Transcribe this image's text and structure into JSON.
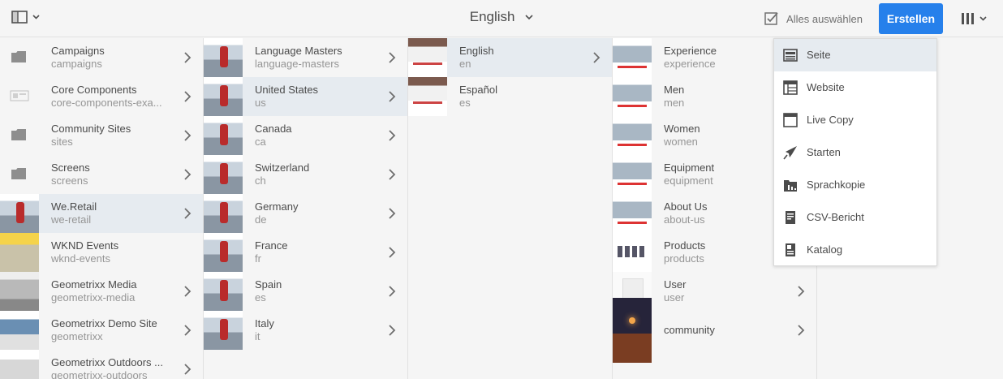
{
  "topbar": {
    "title": "English",
    "select_all": "Alles auswählen",
    "create": "Erstellen"
  },
  "col1": [
    {
      "title": "Campaigns",
      "name": "campaigns",
      "icon": "folder-icon"
    },
    {
      "title": "Core Components",
      "name": "core-components-exa...",
      "icon": "component-icon"
    },
    {
      "title": "Community Sites",
      "name": "sites",
      "icon": "folder-icon"
    },
    {
      "title": "Screens",
      "name": "screens",
      "icon": "folder-icon"
    },
    {
      "title": "We.Retail",
      "name": "we-retail",
      "selected": true
    },
    {
      "title": "WKND Events",
      "name": "wknd-events"
    },
    {
      "title": "Geometrixx Media",
      "name": "geometrixx-media"
    },
    {
      "title": "Geometrixx Demo Site",
      "name": "geometrixx"
    },
    {
      "title": "Geometrixx Outdoors ...",
      "name": "geometrixx-outdoors"
    }
  ],
  "col2": [
    {
      "title": "Language Masters",
      "name": "language-masters"
    },
    {
      "title": "United States",
      "name": "us",
      "selected": true
    },
    {
      "title": "Canada",
      "name": "ca"
    },
    {
      "title": "Switzerland",
      "name": "ch"
    },
    {
      "title": "Germany",
      "name": "de"
    },
    {
      "title": "France",
      "name": "fr"
    },
    {
      "title": "Spain",
      "name": "es"
    },
    {
      "title": "Italy",
      "name": "it"
    }
  ],
  "col3": [
    {
      "title": "English",
      "name": "en",
      "selected": true
    },
    {
      "title": "Español",
      "name": "es"
    }
  ],
  "col4": [
    {
      "title": "Experience",
      "name": "experience"
    },
    {
      "title": "Men",
      "name": "men"
    },
    {
      "title": "Women",
      "name": "women"
    },
    {
      "title": "Equipment",
      "name": "equipment"
    },
    {
      "title": "About Us",
      "name": "about-us"
    },
    {
      "title": "Products",
      "name": "products"
    },
    {
      "title": "User",
      "name": "user"
    },
    {
      "title": "community",
      "name": ""
    }
  ],
  "create_menu": [
    {
      "label": "Seite",
      "icon": "page-icon"
    },
    {
      "label": "Website",
      "icon": "website-icon"
    },
    {
      "label": "Live Copy",
      "icon": "live-copy-icon"
    },
    {
      "label": "Starten",
      "icon": "launch-icon"
    },
    {
      "label": "Sprachkopie",
      "icon": "language-copy-icon"
    },
    {
      "label": "CSV-Bericht",
      "icon": "csv-report-icon"
    },
    {
      "label": "Katalog",
      "icon": "catalog-icon"
    }
  ],
  "colors": {
    "accent": "#2680eb",
    "selected_row": "#e6ebf0"
  }
}
